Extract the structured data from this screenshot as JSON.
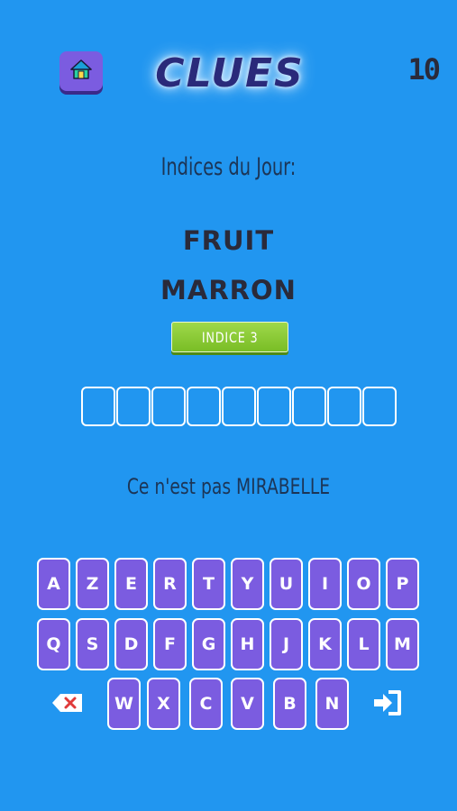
{
  "header": {
    "logo_text": "CLUES",
    "score": "10",
    "home_icon": "home-icon"
  },
  "game": {
    "subtitle": "Indices du Jour:",
    "clues": [
      "FRUIT",
      "MARRON"
    ],
    "hint_button_label": "INDICE 3",
    "answer_slots": 9,
    "message": "Ce n'est pas MIRABELLE"
  },
  "keyboard": {
    "row1": [
      "A",
      "Z",
      "E",
      "R",
      "T",
      "Y",
      "U",
      "I",
      "O",
      "P"
    ],
    "row2": [
      "Q",
      "S",
      "D",
      "F",
      "G",
      "H",
      "J",
      "K",
      "L",
      "M"
    ],
    "row3": [
      "W",
      "X",
      "C",
      "V",
      "B",
      "N"
    ],
    "backspace_icon": "backspace-icon",
    "submit_icon": "submit-icon"
  },
  "colors": {
    "background": "#2196f0",
    "key": "#7b5ce0",
    "hint_button": "#8ccc35",
    "text_dark": "#2a2a3a"
  }
}
